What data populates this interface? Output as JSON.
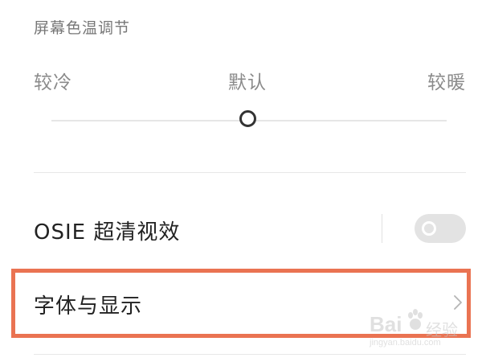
{
  "color_temperature": {
    "title": "屏幕色温调节",
    "cold_label": "较冷",
    "default_label": "默认",
    "warm_label": "较暖",
    "slider_value": "默认"
  },
  "osie": {
    "label": "OSIE 超清视效",
    "enabled": false
  },
  "font_display": {
    "label": "字体与显示",
    "chevron_icon": "chevron-right-icon"
  },
  "highlight_color": "#ea7352",
  "watermark": {
    "brand": "Bai",
    "product": "经验",
    "url": "jingyan.baidu.com"
  }
}
